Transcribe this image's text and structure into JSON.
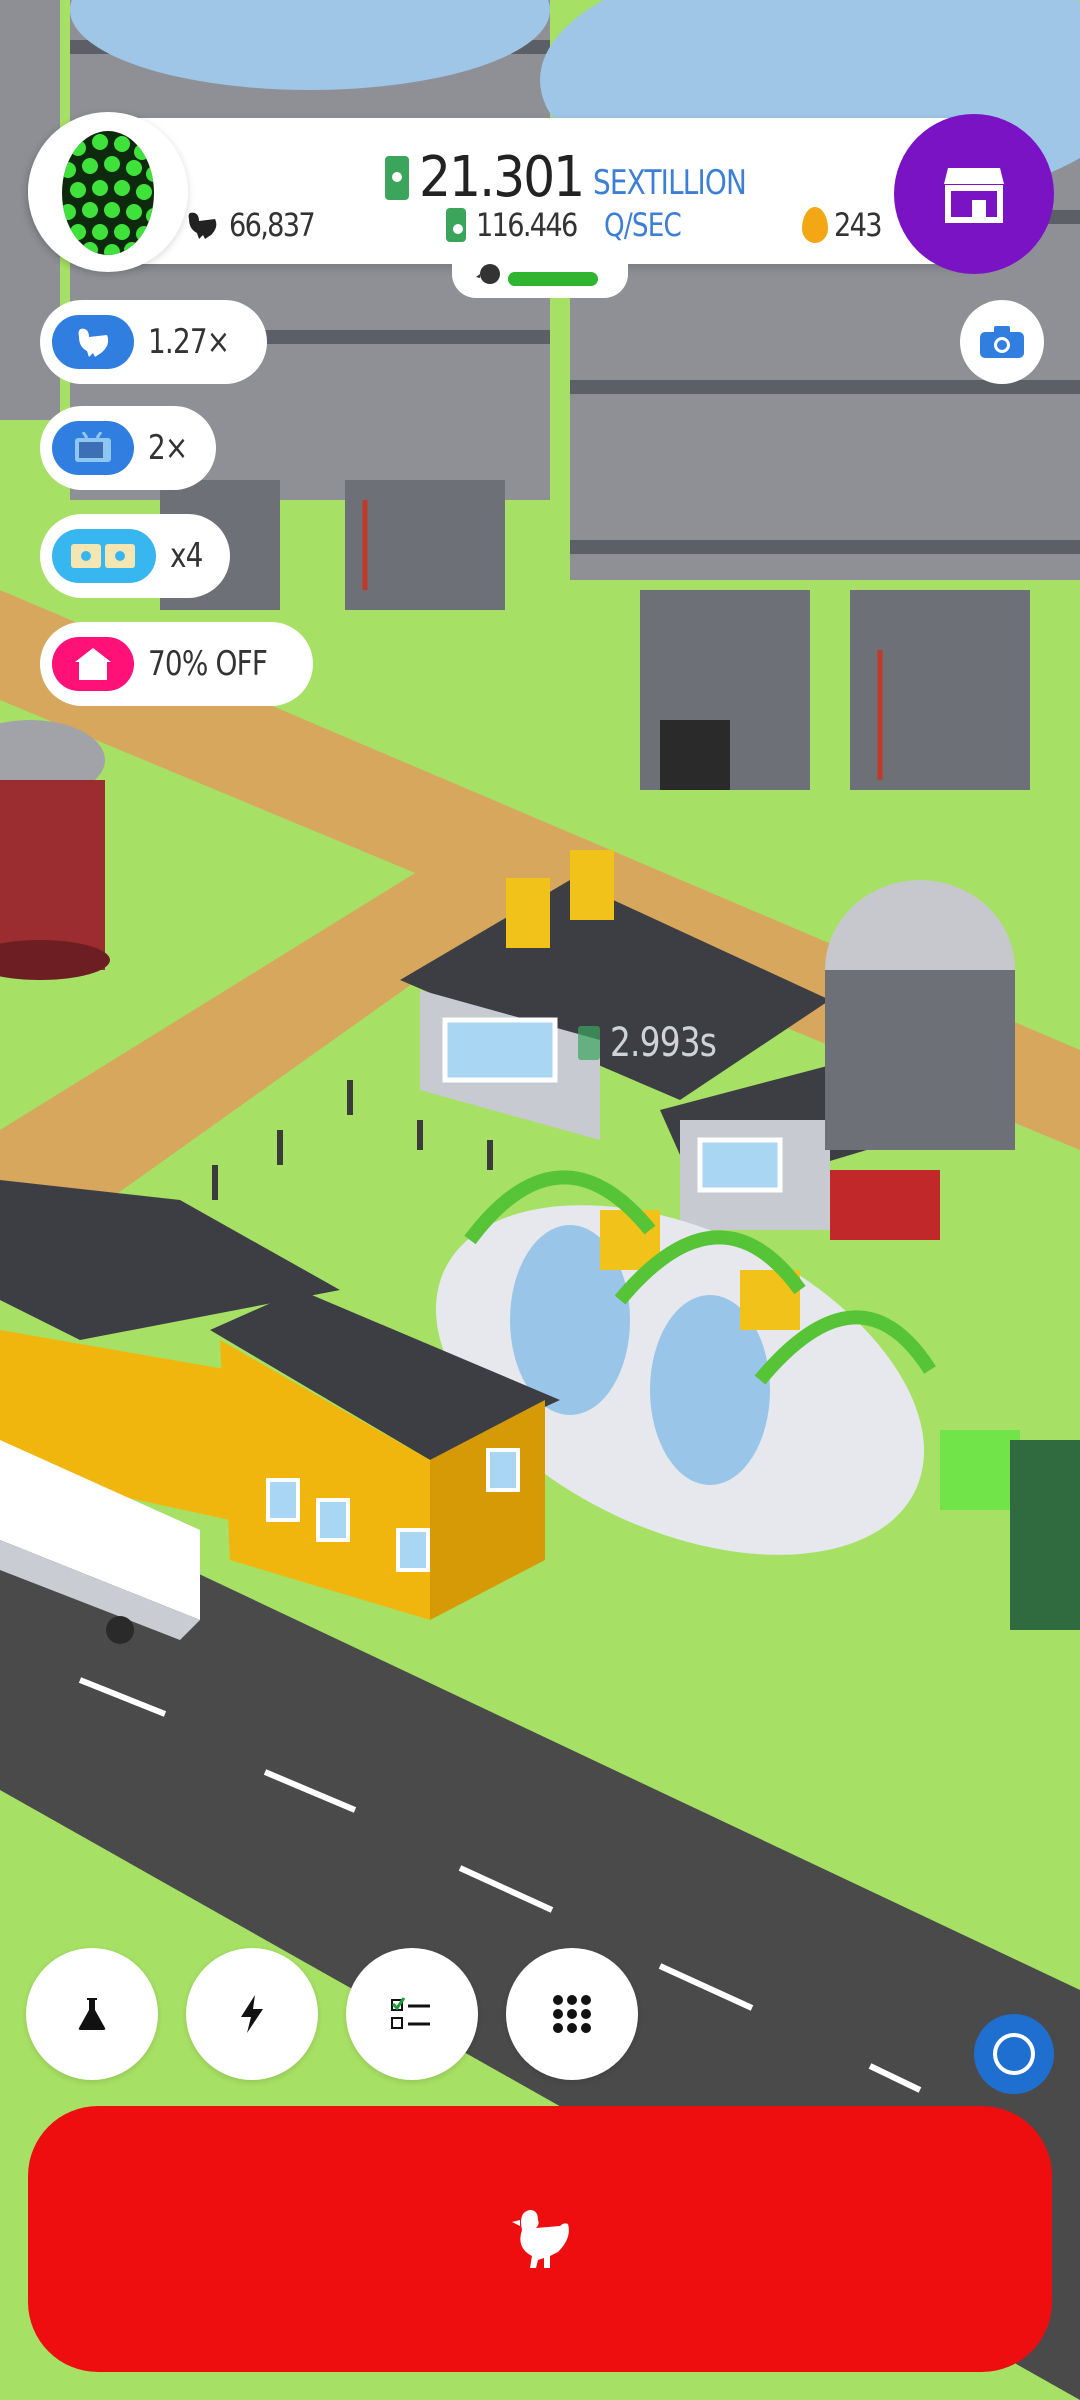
{
  "hud": {
    "money_value": "21.301",
    "money_unit": "SEXTILLION",
    "chicken_count": "66,837",
    "rate_value": "116.446",
    "rate_unit": "Q/SEC",
    "golden_eggs": "243",
    "habitat_fill": 0.85
  },
  "boosts": [
    {
      "label": "1.27×",
      "icon": "chicken-icon",
      "color": "#2f7ee0"
    },
    {
      "label": "2×",
      "icon": "tv-icon",
      "color": "#2f7ee0"
    },
    {
      "label": "x4",
      "icon": "tickets-icon",
      "color": "#38b6f0"
    },
    {
      "label": "70% OFF",
      "icon": "house-icon",
      "color": "#ff1177"
    }
  ],
  "farm": {
    "hatchery_timer": "2.993s"
  },
  "toolbar": {
    "items": [
      "research-icon",
      "lightning-icon",
      "checklist-icon",
      "grid-icon"
    ]
  },
  "colors": {
    "shop_button": "#7a13c4",
    "hatch_button": "#ee0e10",
    "grass": "#a6e064",
    "road": "#4a4a4a"
  },
  "hatch": {
    "icon": "chicken-icon"
  }
}
